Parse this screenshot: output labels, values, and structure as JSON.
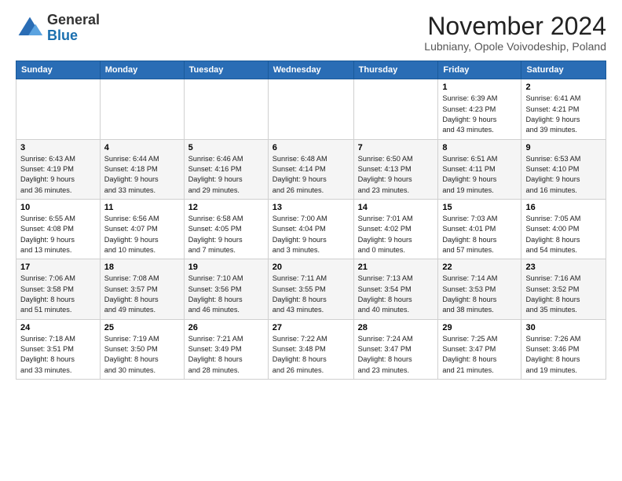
{
  "logo": {
    "general": "General",
    "blue": "Blue"
  },
  "header": {
    "month": "November 2024",
    "location": "Lubniany, Opole Voivodeship, Poland"
  },
  "columns": [
    "Sunday",
    "Monday",
    "Tuesday",
    "Wednesday",
    "Thursday",
    "Friday",
    "Saturday"
  ],
  "weeks": [
    [
      {
        "day": "",
        "info": ""
      },
      {
        "day": "",
        "info": ""
      },
      {
        "day": "",
        "info": ""
      },
      {
        "day": "",
        "info": ""
      },
      {
        "day": "",
        "info": ""
      },
      {
        "day": "1",
        "info": "Sunrise: 6:39 AM\nSunset: 4:23 PM\nDaylight: 9 hours\nand 43 minutes."
      },
      {
        "day": "2",
        "info": "Sunrise: 6:41 AM\nSunset: 4:21 PM\nDaylight: 9 hours\nand 39 minutes."
      }
    ],
    [
      {
        "day": "3",
        "info": "Sunrise: 6:43 AM\nSunset: 4:19 PM\nDaylight: 9 hours\nand 36 minutes."
      },
      {
        "day": "4",
        "info": "Sunrise: 6:44 AM\nSunset: 4:18 PM\nDaylight: 9 hours\nand 33 minutes."
      },
      {
        "day": "5",
        "info": "Sunrise: 6:46 AM\nSunset: 4:16 PM\nDaylight: 9 hours\nand 29 minutes."
      },
      {
        "day": "6",
        "info": "Sunrise: 6:48 AM\nSunset: 4:14 PM\nDaylight: 9 hours\nand 26 minutes."
      },
      {
        "day": "7",
        "info": "Sunrise: 6:50 AM\nSunset: 4:13 PM\nDaylight: 9 hours\nand 23 minutes."
      },
      {
        "day": "8",
        "info": "Sunrise: 6:51 AM\nSunset: 4:11 PM\nDaylight: 9 hours\nand 19 minutes."
      },
      {
        "day": "9",
        "info": "Sunrise: 6:53 AM\nSunset: 4:10 PM\nDaylight: 9 hours\nand 16 minutes."
      }
    ],
    [
      {
        "day": "10",
        "info": "Sunrise: 6:55 AM\nSunset: 4:08 PM\nDaylight: 9 hours\nand 13 minutes."
      },
      {
        "day": "11",
        "info": "Sunrise: 6:56 AM\nSunset: 4:07 PM\nDaylight: 9 hours\nand 10 minutes."
      },
      {
        "day": "12",
        "info": "Sunrise: 6:58 AM\nSunset: 4:05 PM\nDaylight: 9 hours\nand 7 minutes."
      },
      {
        "day": "13",
        "info": "Sunrise: 7:00 AM\nSunset: 4:04 PM\nDaylight: 9 hours\nand 3 minutes."
      },
      {
        "day": "14",
        "info": "Sunrise: 7:01 AM\nSunset: 4:02 PM\nDaylight: 9 hours\nand 0 minutes."
      },
      {
        "day": "15",
        "info": "Sunrise: 7:03 AM\nSunset: 4:01 PM\nDaylight: 8 hours\nand 57 minutes."
      },
      {
        "day": "16",
        "info": "Sunrise: 7:05 AM\nSunset: 4:00 PM\nDaylight: 8 hours\nand 54 minutes."
      }
    ],
    [
      {
        "day": "17",
        "info": "Sunrise: 7:06 AM\nSunset: 3:58 PM\nDaylight: 8 hours\nand 51 minutes."
      },
      {
        "day": "18",
        "info": "Sunrise: 7:08 AM\nSunset: 3:57 PM\nDaylight: 8 hours\nand 49 minutes."
      },
      {
        "day": "19",
        "info": "Sunrise: 7:10 AM\nSunset: 3:56 PM\nDaylight: 8 hours\nand 46 minutes."
      },
      {
        "day": "20",
        "info": "Sunrise: 7:11 AM\nSunset: 3:55 PM\nDaylight: 8 hours\nand 43 minutes."
      },
      {
        "day": "21",
        "info": "Sunrise: 7:13 AM\nSunset: 3:54 PM\nDaylight: 8 hours\nand 40 minutes."
      },
      {
        "day": "22",
        "info": "Sunrise: 7:14 AM\nSunset: 3:53 PM\nDaylight: 8 hours\nand 38 minutes."
      },
      {
        "day": "23",
        "info": "Sunrise: 7:16 AM\nSunset: 3:52 PM\nDaylight: 8 hours\nand 35 minutes."
      }
    ],
    [
      {
        "day": "24",
        "info": "Sunrise: 7:18 AM\nSunset: 3:51 PM\nDaylight: 8 hours\nand 33 minutes."
      },
      {
        "day": "25",
        "info": "Sunrise: 7:19 AM\nSunset: 3:50 PM\nDaylight: 8 hours\nand 30 minutes."
      },
      {
        "day": "26",
        "info": "Sunrise: 7:21 AM\nSunset: 3:49 PM\nDaylight: 8 hours\nand 28 minutes."
      },
      {
        "day": "27",
        "info": "Sunrise: 7:22 AM\nSunset: 3:48 PM\nDaylight: 8 hours\nand 26 minutes."
      },
      {
        "day": "28",
        "info": "Sunrise: 7:24 AM\nSunset: 3:47 PM\nDaylight: 8 hours\nand 23 minutes."
      },
      {
        "day": "29",
        "info": "Sunrise: 7:25 AM\nSunset: 3:47 PM\nDaylight: 8 hours\nand 21 minutes."
      },
      {
        "day": "30",
        "info": "Sunrise: 7:26 AM\nSunset: 3:46 PM\nDaylight: 8 hours\nand 19 minutes."
      }
    ]
  ]
}
